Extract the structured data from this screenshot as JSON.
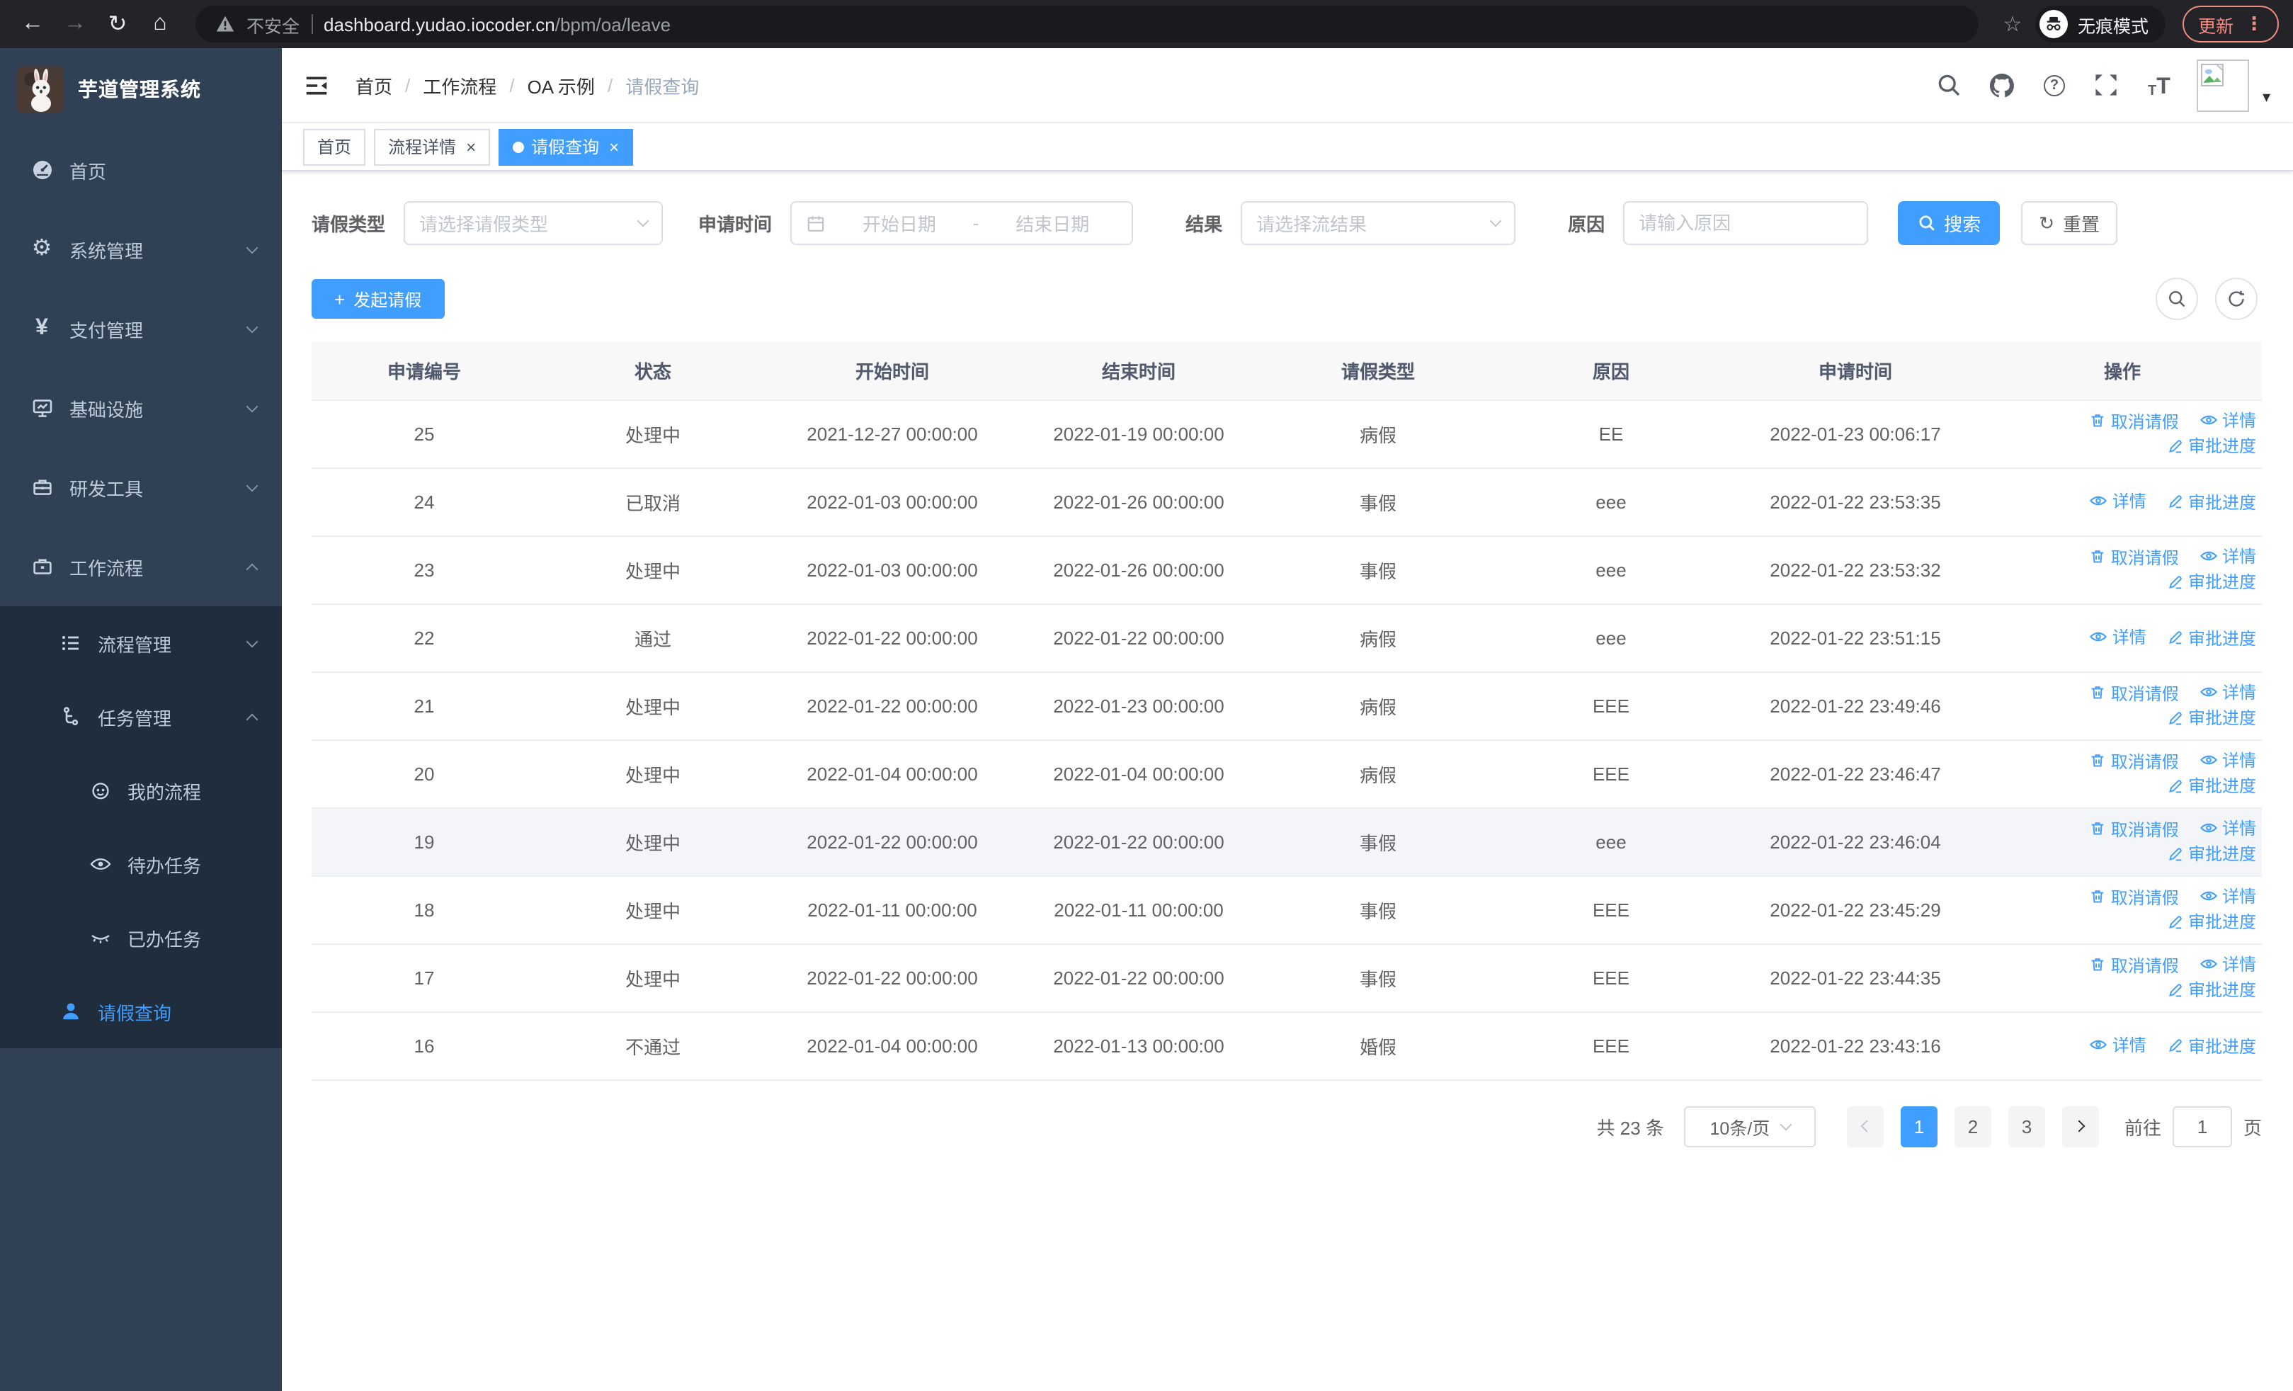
{
  "glyphs": {
    "back": "←",
    "forward": "→",
    "refresh": "↻",
    "home": "⌂",
    "star": "☆",
    "dots": "⋮",
    "caret": "▾",
    "plus": "+",
    "question": "?",
    "close": "×",
    "slash": "/",
    "yen": "¥",
    "gear": "⚙",
    "t": "T",
    "range_sep": "-"
  },
  "browser": {
    "security_label": "不安全",
    "url_host": "dashboard.yudao.iocoder.cn",
    "url_path": "/bpm/oa/leave",
    "incognito_label": "无痕模式",
    "update_label": "更新"
  },
  "sidebar": {
    "app_title": "芋道管理系统",
    "items": [
      {
        "label": "首页"
      },
      {
        "label": "系统管理"
      },
      {
        "label": "支付管理"
      },
      {
        "label": "基础设施"
      },
      {
        "label": "研发工具"
      },
      {
        "label": "工作流程"
      }
    ],
    "submenu": {
      "process_mgmt": "流程管理",
      "task_mgmt": "任务管理",
      "my_process": "我的流程",
      "todo_tasks": "待办任务",
      "done_tasks": "已办任务",
      "leave_query": "请假查询"
    }
  },
  "header": {
    "breadcrumb": [
      "首页",
      "工作流程",
      "OA 示例",
      "请假查询"
    ]
  },
  "tabs": {
    "close_glyph": "×",
    "items": [
      {
        "label": "首页"
      },
      {
        "label": "流程详情",
        "closable": true
      },
      {
        "label": "请假查询",
        "closable": true,
        "active": true,
        "dot": true
      }
    ]
  },
  "filters": {
    "leave_type_label": "请假类型",
    "leave_type_placeholder": "请选择请假类型",
    "apply_time_label": "申请时间",
    "start_placeholder": "开始日期",
    "range_separator": "-",
    "end_placeholder": "结束日期",
    "result_label": "结果",
    "result_placeholder": "请选择流结果",
    "reason_label": "原因",
    "reason_placeholder": "请输入原因",
    "search_label": "搜索",
    "reset_label": "重置"
  },
  "toolbar": {
    "create_label": "发起请假"
  },
  "table": {
    "columns": [
      "申请编号",
      "状态",
      "开始时间",
      "结束时间",
      "请假类型",
      "原因",
      "申请时间",
      "操作"
    ],
    "actions": {
      "cancel": "取消请假",
      "detail": "详情",
      "progress": "审批进度"
    },
    "rows": [
      {
        "id": "25",
        "status": "处理中",
        "start": "2021-12-27 00:00:00",
        "end": "2022-01-19 00:00:00",
        "type": "病假",
        "reason": "EE",
        "apply": "2022-01-23 00:06:17",
        "can_cancel": true
      },
      {
        "id": "24",
        "status": "已取消",
        "start": "2022-01-03 00:00:00",
        "end": "2022-01-26 00:00:00",
        "type": "事假",
        "reason": "eee",
        "apply": "2022-01-22 23:53:35",
        "can_cancel": false
      },
      {
        "id": "23",
        "status": "处理中",
        "start": "2022-01-03 00:00:00",
        "end": "2022-01-26 00:00:00",
        "type": "事假",
        "reason": "eee",
        "apply": "2022-01-22 23:53:32",
        "can_cancel": true
      },
      {
        "id": "22",
        "status": "通过",
        "start": "2022-01-22 00:00:00",
        "end": "2022-01-22 00:00:00",
        "type": "病假",
        "reason": "eee",
        "apply": "2022-01-22 23:51:15",
        "can_cancel": false
      },
      {
        "id": "21",
        "status": "处理中",
        "start": "2022-01-22 00:00:00",
        "end": "2022-01-23 00:00:00",
        "type": "病假",
        "reason": "EEE",
        "apply": "2022-01-22 23:49:46",
        "can_cancel": true
      },
      {
        "id": "20",
        "status": "处理中",
        "start": "2022-01-04 00:00:00",
        "end": "2022-01-04 00:00:00",
        "type": "病假",
        "reason": "EEE",
        "apply": "2022-01-22 23:46:47",
        "can_cancel": true
      },
      {
        "id": "19",
        "status": "处理中",
        "start": "2022-01-22 00:00:00",
        "end": "2022-01-22 00:00:00",
        "type": "事假",
        "reason": "eee",
        "apply": "2022-01-22 23:46:04",
        "can_cancel": true,
        "highlighted": true
      },
      {
        "id": "18",
        "status": "处理中",
        "start": "2022-01-11 00:00:00",
        "end": "2022-01-11 00:00:00",
        "type": "事假",
        "reason": "EEE",
        "apply": "2022-01-22 23:45:29",
        "can_cancel": true
      },
      {
        "id": "17",
        "status": "处理中",
        "start": "2022-01-22 00:00:00",
        "end": "2022-01-22 00:00:00",
        "type": "事假",
        "reason": "EEE",
        "apply": "2022-01-22 23:44:35",
        "can_cancel": true
      },
      {
        "id": "16",
        "status": "不通过",
        "start": "2022-01-04 00:00:00",
        "end": "2022-01-13 00:00:00",
        "type": "婚假",
        "reason": "EEE",
        "apply": "2022-01-22 23:43:16",
        "can_cancel": false
      }
    ]
  },
  "pagination": {
    "total": "共 23 条",
    "page_size": "10条/页",
    "pages": [
      {
        "label": "1",
        "active": true
      },
      {
        "label": "2"
      },
      {
        "label": "3"
      }
    ],
    "goto": "前往",
    "goto_value": "1",
    "unit": "页"
  },
  "colors": {
    "accent": "#409eff",
    "sidebar_bg": "#304156",
    "submenu_bg": "#1f2d3d",
    "update_accent": "#f28b82"
  }
}
